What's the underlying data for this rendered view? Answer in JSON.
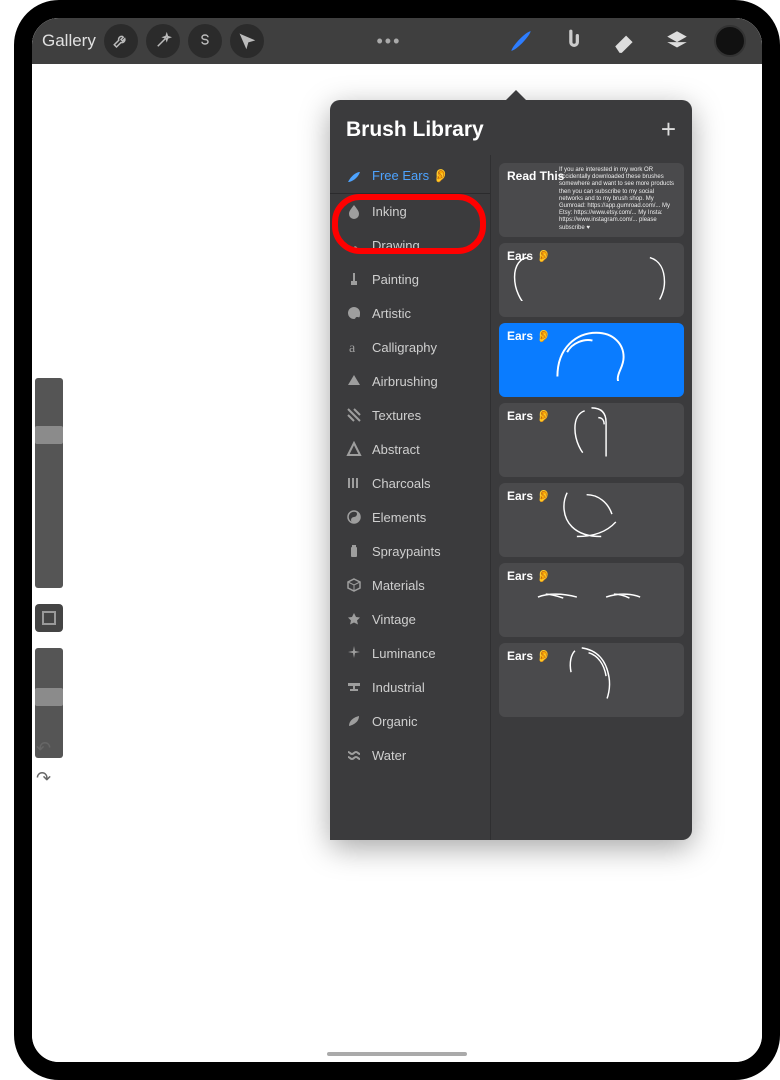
{
  "toolbar": {
    "gallery_label": "Gallery"
  },
  "popover": {
    "title": "Brush Library",
    "categories": [
      {
        "label": "Free Ears 👂",
        "active": true,
        "icon": "brushstroke"
      },
      {
        "label": "Inking",
        "icon": "drop"
      },
      {
        "label": "Drawing",
        "icon": "squiggle"
      },
      {
        "label": "Painting",
        "icon": "paintbrush"
      },
      {
        "label": "Artistic",
        "icon": "palette"
      },
      {
        "label": "Calligraphy",
        "icon": "script-a"
      },
      {
        "label": "Airbrushing",
        "icon": "spray"
      },
      {
        "label": "Textures",
        "icon": "hatch"
      },
      {
        "label": "Abstract",
        "icon": "triangle"
      },
      {
        "label": "Charcoals",
        "icon": "lines"
      },
      {
        "label": "Elements",
        "icon": "yinyang"
      },
      {
        "label": "Spraypaints",
        "icon": "canister"
      },
      {
        "label": "Materials",
        "icon": "cube"
      },
      {
        "label": "Vintage",
        "icon": "star"
      },
      {
        "label": "Luminance",
        "icon": "sparkle"
      },
      {
        "label": "Industrial",
        "icon": "anvil"
      },
      {
        "label": "Organic",
        "icon": "leaf"
      },
      {
        "label": "Water",
        "icon": "waves"
      }
    ],
    "brushes": [
      {
        "name": "Read This",
        "selected": false,
        "kind": "readme"
      },
      {
        "name": "Ears 👂",
        "selected": false,
        "kind": "ear1"
      },
      {
        "name": "Ears 👂",
        "selected": true,
        "kind": "ear2"
      },
      {
        "name": "Ears 👂",
        "selected": false,
        "kind": "ear3"
      },
      {
        "name": "Ears 👂",
        "selected": false,
        "kind": "ear4"
      },
      {
        "name": "Ears 👂",
        "selected": false,
        "kind": "ear5"
      },
      {
        "name": "Ears 👂",
        "selected": false,
        "kind": "ear6"
      }
    ],
    "readme_text": "If you are interested in my work OR accidentally downloaded these brushes somewhere and want to see more products then you can subscribe to my social networks and to my brush shop. My Gumroad: https://app.gumroad.com/... My Etsy: https://www.etsy.com/... My Insta: https://www.instagram.com/... please subscribe ♥"
  }
}
